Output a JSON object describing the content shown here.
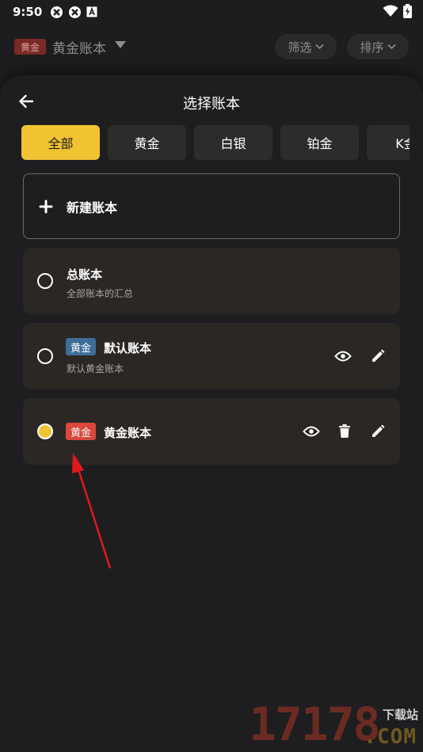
{
  "status_bar": {
    "time": "9:50"
  },
  "background_header": {
    "tag": "黄金",
    "title": "黄金账本",
    "filter_label": "筛选",
    "sort_label": "排序"
  },
  "sheet": {
    "title": "选择账本",
    "tabs": [
      "全部",
      "黄金",
      "白银",
      "铂金",
      "K金"
    ],
    "active_tab": "全部",
    "new_book_label": "新建账本",
    "books": [
      {
        "title": "总账本",
        "subtitle": "全部账本的汇总",
        "selected": false
      },
      {
        "badge": "黄金",
        "badge_color": "#3d6e99",
        "title": "默认账本",
        "subtitle": "默认黄金账本",
        "selected": false
      },
      {
        "badge": "黄金",
        "badge_color": "#d9483b",
        "title": "黄金账本",
        "selected": true
      }
    ]
  },
  "watermark": {
    "number": "17178",
    "suffix_top": "下载站",
    "suffix_bottom": ".COM"
  },
  "colors": {
    "accent": "#f1c332",
    "card": "#2a2724",
    "annotation_arrow": "#e0191b"
  }
}
